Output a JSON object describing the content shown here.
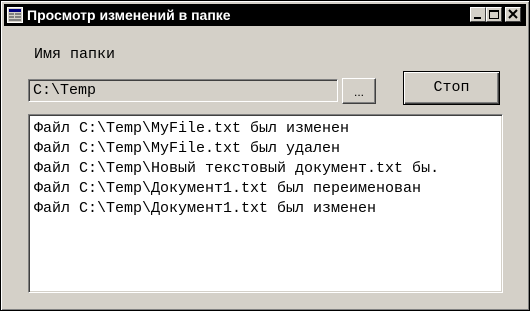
{
  "window": {
    "title": "Просмотр изменений в папке",
    "title_icon": "application-icon",
    "controls": [
      "minimize-icon",
      "maximize-icon",
      "close-icon"
    ]
  },
  "folder": {
    "label": "Имя папки",
    "value": "C:\\Temp",
    "browse_label": "...",
    "stop_label": "Стоп"
  },
  "log": {
    "lines": [
      "Файл C:\\Temp\\MyFile.txt был изменен",
      "Файл C:\\Temp\\MyFile.txt был удален",
      "Файл C:\\Temp\\Новый текстовый документ.txt бы.",
      "Файл C:\\Temp\\Документ1.txt был переименован",
      "Файл C:\\Temp\\Документ1.txt был изменен"
    ]
  },
  "colors": {
    "window_bg": "#d4d0c8",
    "titlebar_bg": "#000000",
    "titlebar_text": "#ffffff",
    "list_bg": "#ffffff"
  }
}
